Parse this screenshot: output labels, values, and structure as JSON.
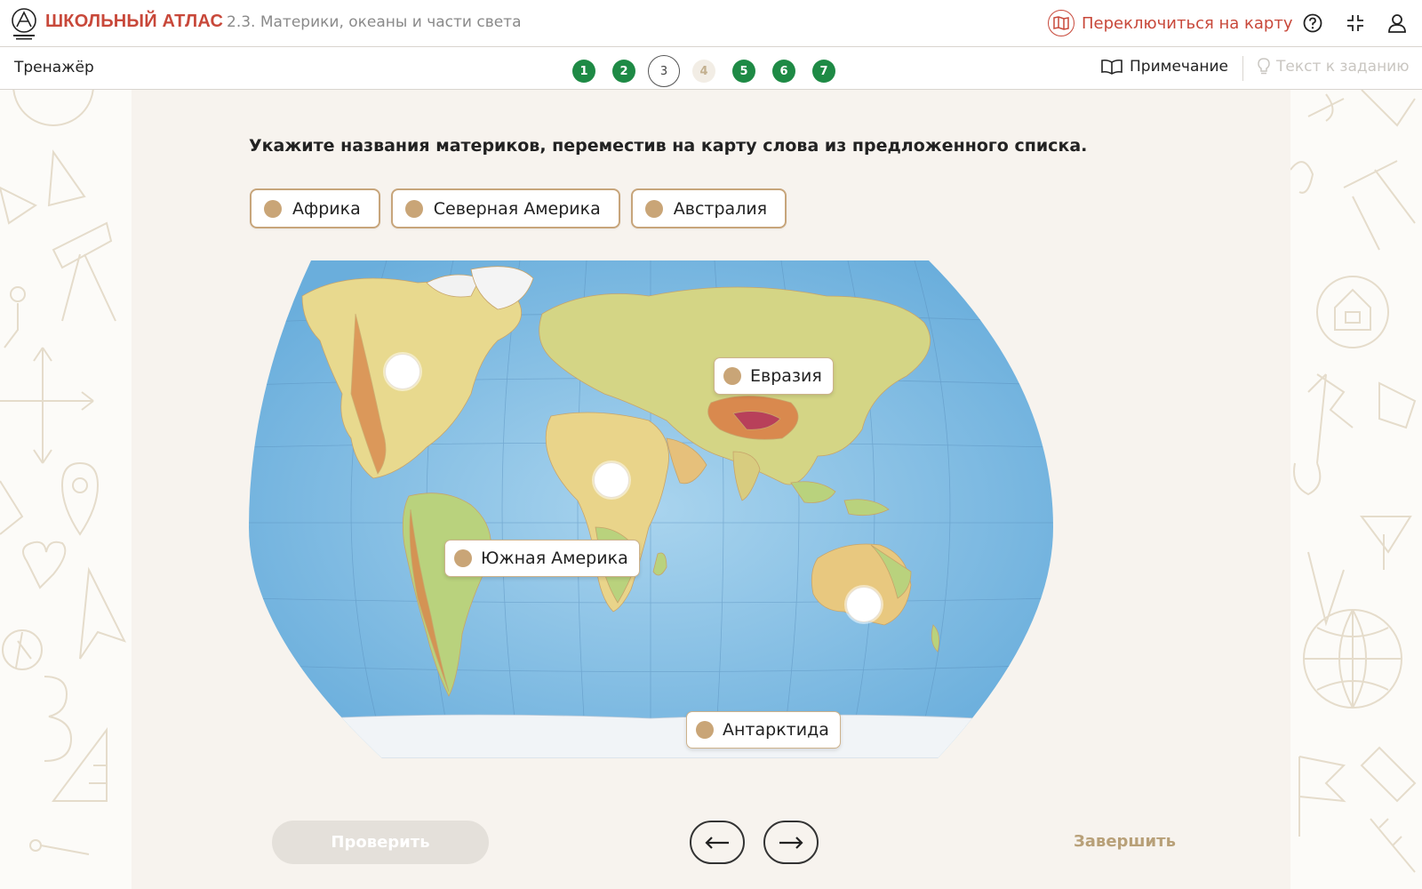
{
  "header": {
    "brand": "ШКОЛЬНЫЙ АТЛАС",
    "breadcrumb": "2.3. Материки, океаны и части света",
    "switch_map": "Переключиться на карту"
  },
  "subbar": {
    "title": "Тренажёр",
    "steps": [
      {
        "label": "1",
        "state": "done"
      },
      {
        "label": "2",
        "state": "done"
      },
      {
        "label": "3",
        "state": "current"
      },
      {
        "label": "4",
        "state": "locked"
      },
      {
        "label": "5",
        "state": "done"
      },
      {
        "label": "6",
        "state": "done"
      },
      {
        "label": "7",
        "state": "done"
      }
    ],
    "note": "Примечание",
    "task_text": "Текст к заданию"
  },
  "task": {
    "question": "Укажите названия материков, переместив на карту слова из предложенного списка.",
    "chips": [
      "Африка",
      "Северная Америка",
      "Австралия"
    ],
    "placed": {
      "eurasia": "Евразия",
      "south_america": "Южная Америка",
      "antarctica": "Антарктида"
    }
  },
  "footer": {
    "check": "Проверить",
    "finish": "Завершить"
  },
  "colors": {
    "accent": "#c8483a",
    "step_done": "#1e8a45",
    "chip_dot": "#c9a577"
  }
}
